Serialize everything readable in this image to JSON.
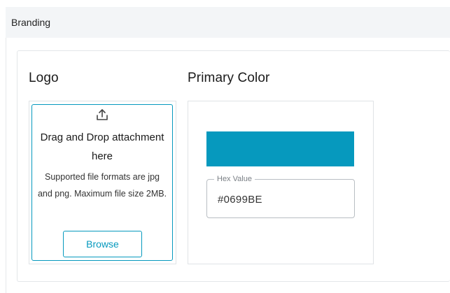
{
  "section": {
    "title": "Branding"
  },
  "logo": {
    "heading": "Logo",
    "upload_icon": "upload-icon",
    "upload_title": "Drag and Drop attachment here",
    "upload_description": "Supported file formats are jpg and png. Maximum file size 2MB.",
    "browse_label": "Browse"
  },
  "primary_color": {
    "heading": "Primary Color",
    "swatch_color": "#0699BE",
    "hex_label": "Hex Value",
    "hex_value": "#0699BE"
  },
  "colors": {
    "accent": "#0699BE"
  }
}
